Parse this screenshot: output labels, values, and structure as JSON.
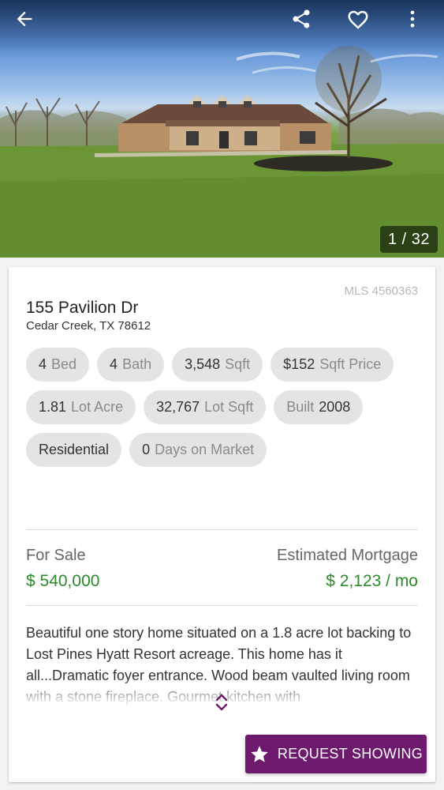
{
  "photo": {
    "counter": "1 / 32",
    "icons": [
      "back-arrow-icon",
      "share-icon",
      "heart-icon",
      "more-vert-icon"
    ]
  },
  "listing": {
    "mls": "MLS 4560363",
    "address_line1": "155 Pavilion Dr",
    "address_line2": "Cedar Creek, TX 78612",
    "chips": [
      {
        "value": "4",
        "unit": "Bed"
      },
      {
        "value": "4",
        "unit": "Bath"
      },
      {
        "value": "3,548",
        "unit": "Sqft"
      },
      {
        "value": "$152",
        "unit": "Sqft Price"
      },
      {
        "value": "1.81",
        "unit": "Lot Acre"
      },
      {
        "value": "32,767",
        "unit": "Lot Sqft"
      },
      {
        "value": "2008",
        "prefix": "Built"
      },
      {
        "value": "Residential"
      },
      {
        "value": "0",
        "unit": "Days on Market"
      }
    ],
    "for_sale_label": "For Sale",
    "price": "$ 540,000",
    "mortgage_label": "Estimated Mortgage",
    "mortgage": "$ 2,123 / mo",
    "description": "Beautiful one story home situated on a 1.8 acre lot backing to Lost Pines Hyatt Resort acreage. This home has it all...Dramatic foyer entrance. Wood beam vaulted living room with a stone fireplace. Gourmet kitchen with"
  },
  "actions": {
    "request_showing": "REQUEST SHOWING"
  },
  "colors": {
    "accent": "#6d1a6e",
    "price_green": "#2b8a2b"
  }
}
